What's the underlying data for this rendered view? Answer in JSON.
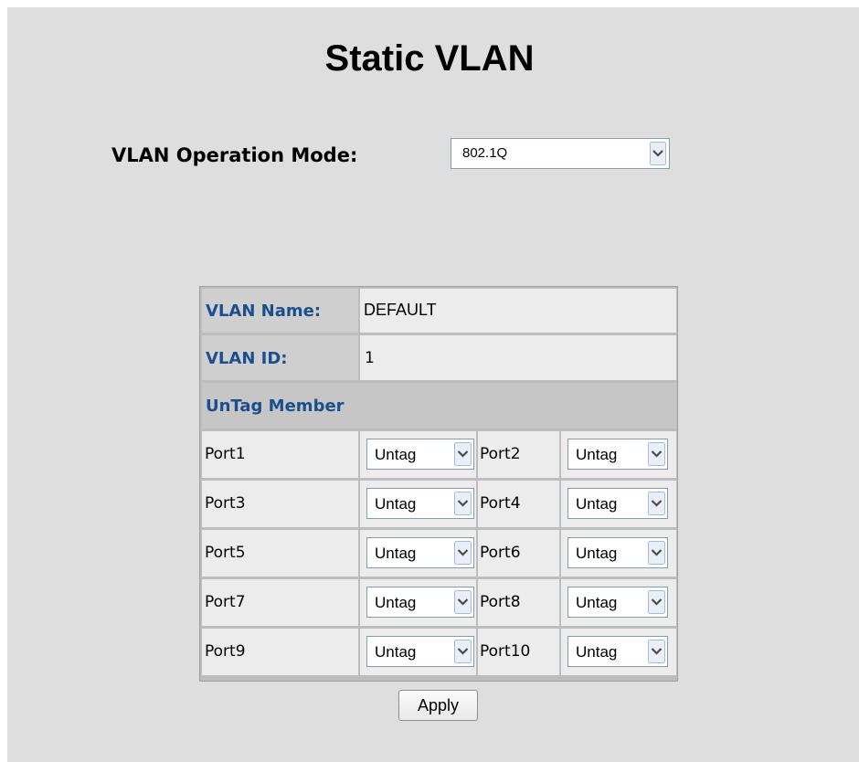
{
  "page": {
    "title": "Static VLAN"
  },
  "mode": {
    "label": "VLAN Operation Mode:",
    "value": "802.1Q"
  },
  "vlan": {
    "name_label": "VLAN Name:",
    "name_value": "DEFAULT",
    "id_label": "VLAN ID:",
    "id_value": "1",
    "untag_header": "UnTag Member"
  },
  "ports": [
    {
      "left_port": "Port1",
      "left_value": "Untag",
      "right_port": "Port2",
      "right_value": "Untag"
    },
    {
      "left_port": "Port3",
      "left_value": "Untag",
      "right_port": "Port4",
      "right_value": "Untag"
    },
    {
      "left_port": "Port5",
      "left_value": "Untag",
      "right_port": "Port6",
      "right_value": "Untag"
    },
    {
      "left_port": "Port7",
      "left_value": "Untag",
      "right_port": "Port8",
      "right_value": "Untag"
    },
    {
      "left_port": "Port9",
      "left_value": "Untag",
      "right_port": "Port10",
      "right_value": "Untag"
    }
  ],
  "actions": {
    "apply_label": "Apply"
  },
  "icons": {
    "dropdown": "chevron-down-icon"
  }
}
